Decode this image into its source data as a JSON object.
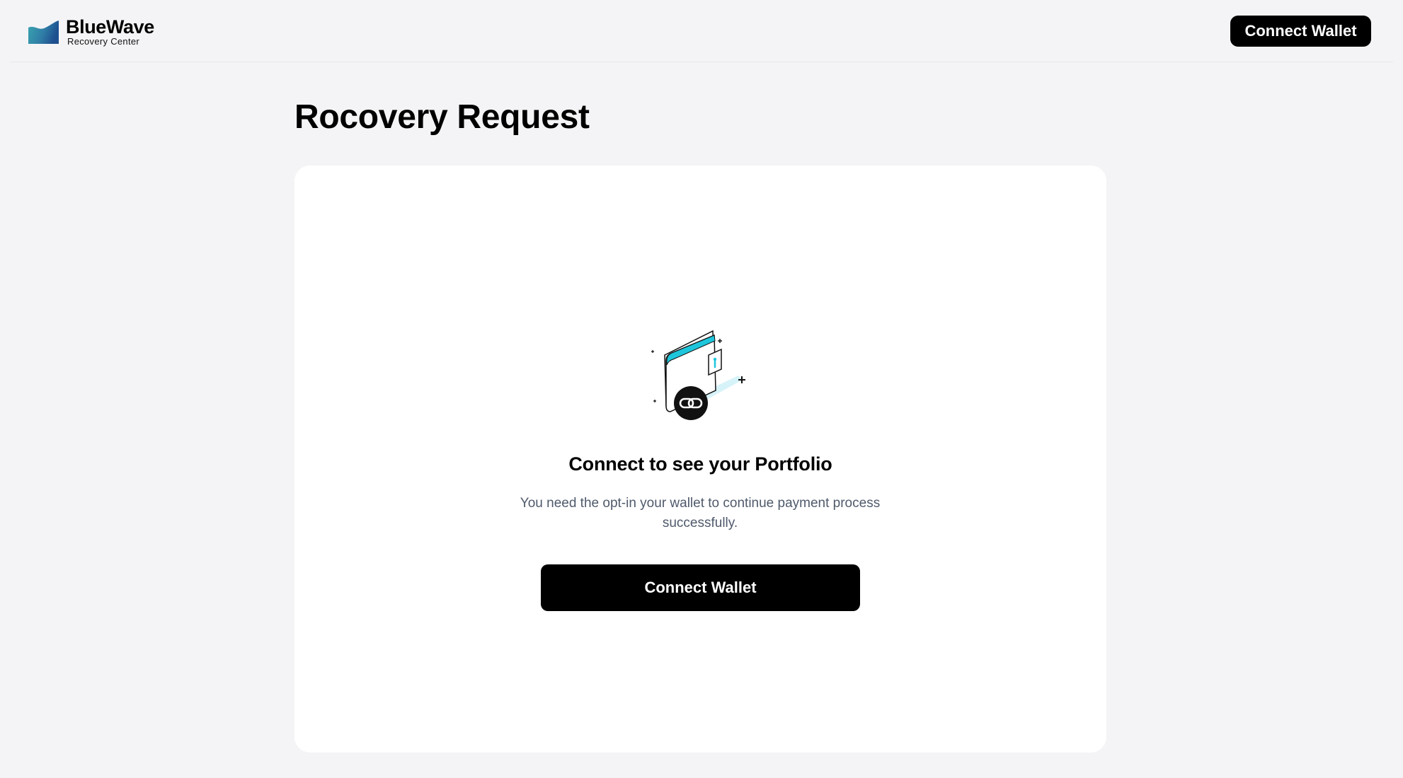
{
  "header": {
    "brand_name": "BlueWave",
    "brand_subtitle": "Recovery Center",
    "connect_label": "Connect Wallet"
  },
  "page": {
    "title": "Rocovery Request"
  },
  "empty_state": {
    "icon": "wallet-link-illustration",
    "title": "Connect to see your Portfolio",
    "description": "You need the opt-in your wallet to continue payment process successfully.",
    "button_label": "Connect Wallet"
  },
  "colors": {
    "background": "#f4f4f6",
    "card": "#ffffff",
    "primary_button": "#000000",
    "accent_cyan": "#1ec6dc",
    "muted_text": "#4f5a6b"
  }
}
